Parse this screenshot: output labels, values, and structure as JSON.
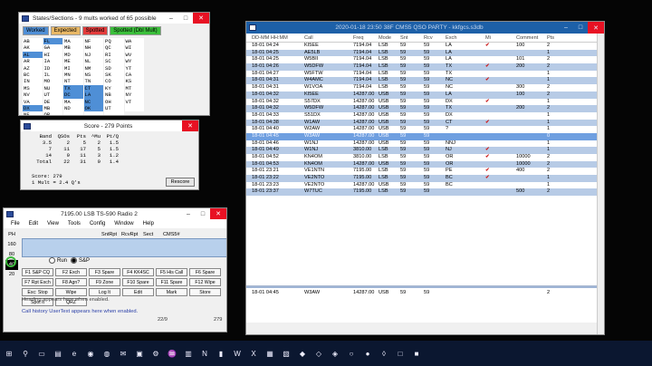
{
  "states_window": {
    "title": "States/Sections - 9 mults worked of 65 possible",
    "legend": [
      {
        "label": "Worked",
        "color": "#4f8fd6"
      },
      {
        "label": "Expected",
        "color": "#e8b765"
      },
      {
        "label": "Spotted",
        "color": "#e33b3b"
      },
      {
        "label": "Spotted (Dbl Mult)",
        "color": "#3bbf3b"
      }
    ],
    "states": [
      "AB",
      "FL",
      "MA",
      "NF",
      "PQ",
      "WA",
      "AK",
      "GA",
      "MB",
      "NH",
      "QC",
      "WI",
      "AL",
      "HI",
      "MD",
      "NJ",
      "RI",
      "WV",
      "AR",
      "IA",
      "ME",
      "NL",
      "SC",
      "WY",
      "AZ",
      "ID",
      "MI",
      "NM",
      "SD",
      "YT",
      "BC",
      "IL",
      "MN",
      "NS",
      "SK",
      "CA",
      "IN",
      "MO",
      "NT",
      "TN",
      "CO",
      "KS",
      "MS",
      "NU",
      "TX",
      "CT",
      "KY",
      "MT",
      "NV",
      "UT",
      "DC",
      "LA",
      "NB",
      "NY",
      "VA",
      "DE",
      "MA",
      "NC",
      "OH",
      "VT",
      "DX",
      "MB",
      "ND",
      "OK",
      "UT",
      "",
      "NE",
      "OR",
      "",
      "",
      ""
    ],
    "worked": [
      "FL",
      "AL",
      "DC",
      "LA",
      "CT",
      "PA",
      "TX",
      "NC",
      "DX",
      "OK"
    ]
  },
  "score_window": {
    "title": "Score - 279 Points",
    "headers": [
      "Band",
      "QSOs",
      "Pts",
      "^Mu",
      "Pt/Q"
    ],
    "rows": [
      [
        "3.5",
        "2",
        "5",
        "2",
        "1.5"
      ],
      [
        "7",
        "11",
        "17",
        "5",
        "1.5"
      ],
      [
        "14",
        "9",
        "11",
        "3",
        "1.2"
      ],
      [
        "Total",
        "22",
        "31",
        "9",
        "1.4"
      ]
    ],
    "footer": "Score: 279",
    "footer2": "1 Mult = 2.4 Q's",
    "rescore_label": "Rescore"
  },
  "entry_window": {
    "title": "7195.00 LSB TS-590 Radio 2",
    "menus": [
      "File",
      "Edit",
      "View",
      "Tools",
      "Config",
      "Window",
      "Help"
    ],
    "bands": [
      "PH",
      "160",
      "80",
      "40",
      "20"
    ],
    "selected_band": "40",
    "field_labels": [
      "SntRpt",
      "RcvRpt",
      "Sect",
      "CMS5#"
    ],
    "radio_run": "Run",
    "radio_sp": "S&P",
    "circle_num": "40",
    "fkeys": [
      "F1 S&P CQ",
      "F2 Exch",
      "F3 Spare",
      "F4 KK4SC",
      "F5 His Call",
      "F6 Spare",
      "F7 Rpt Exch",
      "F8 Agn?",
      "F9 Zone",
      "F10 Spare",
      "F11 Spare",
      "F12 Wipe",
      "Esc: Stop",
      "Wipe",
      "Log It",
      "Edit",
      "Mark",
      "Store",
      "Spot It",
      "QRZ"
    ],
    "msg1": "Heading appears here when enabled.",
    "msg2": "Call history UserText appears here when enabled.",
    "qcount": "22/9",
    "score": "279"
  },
  "log_window": {
    "title": "2020-01-18 23:50 38F  CMS5 QSO PARTY - kkfgcs.s3db",
    "columns": [
      "DD-MM HH:MM",
      "Call",
      "Freq",
      "Mode",
      "Snt",
      "Rcv",
      "Exch",
      "Mi",
      "Comment",
      "Pts"
    ],
    "rows": [
      {
        "dt": "18-01 04:24",
        "call": "KI5EE",
        "freq": "7194.04",
        "mode": "LSB",
        "snt": "59",
        "rcv": "59",
        "exch": "LA",
        "mi": "✔",
        "comment": "100",
        "pts": "2"
      },
      {
        "dt": "18-01 04:25",
        "call": "AE5LB",
        "freq": "7194.04",
        "mode": "LSB",
        "snt": "59",
        "rcv": "59",
        "exch": "LA",
        "mi": "",
        "comment": "",
        "pts": "1"
      },
      {
        "dt": "18-01 04:25",
        "call": "W5BII",
        "freq": "7194.04",
        "mode": "LSB",
        "snt": "59",
        "rcv": "59",
        "exch": "LA",
        "mi": "",
        "comment": "101",
        "pts": "2"
      },
      {
        "dt": "18-01 04:26",
        "call": "W5DFW",
        "freq": "7194.04",
        "mode": "LSB",
        "snt": "59",
        "rcv": "59",
        "exch": "TX",
        "mi": "✔",
        "comment": "200",
        "pts": "2"
      },
      {
        "dt": "18-01 04:27",
        "call": "W5FTW",
        "freq": "7194.04",
        "mode": "LSB",
        "snt": "59",
        "rcv": "59",
        "exch": "TX",
        "mi": "",
        "comment": "",
        "pts": "1"
      },
      {
        "dt": "18-01 04:31",
        "call": "W4AMC",
        "freq": "7194.04",
        "mode": "LSB",
        "snt": "59",
        "rcv": "59",
        "exch": "NC",
        "mi": "✔",
        "comment": "",
        "pts": "1"
      },
      {
        "dt": "18-01 04:31",
        "call": "W1VOA",
        "freq": "7194.04",
        "mode": "LSB",
        "snt": "59",
        "rcv": "59",
        "exch": "NC",
        "mi": "",
        "comment": "300",
        "pts": "2"
      },
      {
        "dt": "18-01 04:32",
        "call": "KI5EE",
        "freq": "14287.00",
        "mode": "USB",
        "snt": "59",
        "rcv": "59",
        "exch": "LA",
        "mi": "",
        "comment": "100",
        "pts": "2"
      },
      {
        "dt": "18-01 04:32",
        "call": "S57DX",
        "freq": "14287.00",
        "mode": "USB",
        "snt": "59",
        "rcv": "59",
        "exch": "DX",
        "mi": "✔",
        "comment": "",
        "pts": "1"
      },
      {
        "dt": "18-01 04:32",
        "call": "W5DFW",
        "freq": "14287.00",
        "mode": "USB",
        "snt": "59",
        "rcv": "59",
        "exch": "TX",
        "mi": "",
        "comment": "200",
        "pts": "2"
      },
      {
        "dt": "18-01 04:33",
        "call": "S51DX",
        "freq": "14287.00",
        "mode": "USB",
        "snt": "59",
        "rcv": "59",
        "exch": "DX",
        "mi": "",
        "comment": "",
        "pts": "1"
      },
      {
        "dt": "18-01 04:38",
        "call": "W1AW",
        "freq": "14287.00",
        "mode": "USB",
        "snt": "59",
        "rcv": "59",
        "exch": "CT",
        "mi": "✔",
        "comment": "",
        "pts": "1"
      },
      {
        "dt": "18-01 04:40",
        "call": "W2AW",
        "freq": "14287.00",
        "mode": "USB",
        "snt": "59",
        "rcv": "59",
        "exch": "?",
        "mi": "",
        "comment": "",
        "pts": "1"
      },
      {
        "dt": "18-01 04:45",
        "call": "W3AW",
        "freq": "14287.00",
        "mode": "USB",
        "snt": "59",
        "rcv": "59",
        "exch": "",
        "mi": "",
        "comment": "",
        "pts": "0"
      },
      {
        "dt": "18-01 04:46",
        "call": "W1NJ",
        "freq": "14287.00",
        "mode": "USB",
        "snt": "59",
        "rcv": "59",
        "exch": "NNJ",
        "mi": "",
        "comment": "",
        "pts": "1"
      },
      {
        "dt": "18-01 04:49",
        "call": "W1NJ",
        "freq": "3810.00",
        "mode": "LSB",
        "snt": "59",
        "rcv": "59",
        "exch": "NJ",
        "mi": "✔",
        "comment": "",
        "pts": "1"
      },
      {
        "dt": "18-01 04:52",
        "call": "KN4OM",
        "freq": "3810.00",
        "mode": "LSB",
        "snt": "59",
        "rcv": "59",
        "exch": "OR",
        "mi": "✔",
        "comment": "10000",
        "pts": "2"
      },
      {
        "dt": "18-01 04:53",
        "call": "KN4OM",
        "freq": "14287.00",
        "mode": "USB",
        "snt": "59",
        "rcv": "59",
        "exch": "OR",
        "mi": "",
        "comment": "10000",
        "pts": "2"
      },
      {
        "dt": "18-01 23:21",
        "call": "VE1NTN",
        "freq": "7195.00",
        "mode": "LSB",
        "snt": "59",
        "rcv": "59",
        "exch": "PE",
        "mi": "✔",
        "comment": "400",
        "pts": "2"
      },
      {
        "dt": "18-01 23:22",
        "call": "VE2NTO",
        "freq": "7195.00",
        "mode": "LSB",
        "snt": "59",
        "rcv": "59",
        "exch": "BC",
        "mi": "✔",
        "comment": "",
        "pts": "1"
      },
      {
        "dt": "18-01 23:23",
        "call": "VE2NTO",
        "freq": "14287.00",
        "mode": "USB",
        "snt": "59",
        "rcv": "59",
        "exch": "BC",
        "mi": "",
        "comment": "",
        "pts": "1"
      },
      {
        "dt": "18-01 23:37",
        "call": "W7TUC",
        "freq": "7195.00",
        "mode": "LSB",
        "snt": "59",
        "rcv": "59",
        "exch": "",
        "mi": "",
        "comment": "500",
        "pts": "2"
      }
    ],
    "bottom_row": {
      "dt": "18-01 04:45",
      "call": "W3AW",
      "freq": "14287.00",
      "mode": "USB",
      "snt": "59",
      "rcv": "59",
      "exch": "",
      "mi": "",
      "comment": "",
      "pts": "2"
    }
  },
  "taskbar": {
    "icons": [
      "start-icon",
      "search-icon",
      "task-view-icon",
      "explorer-icon",
      "edge-icon",
      "firefox-icon",
      "chrome-icon",
      "mail-icon",
      "folder-icon",
      "settings-icon",
      "radio-icon",
      "logger-icon",
      "n1mm-icon",
      "terminal-icon",
      "word-icon",
      "excel-icon",
      "calc-icon",
      "notepad-icon",
      "app-icon",
      "app-icon",
      "app-icon",
      "app-icon",
      "app-icon",
      "app-icon",
      "app-icon",
      "app-icon"
    ]
  }
}
